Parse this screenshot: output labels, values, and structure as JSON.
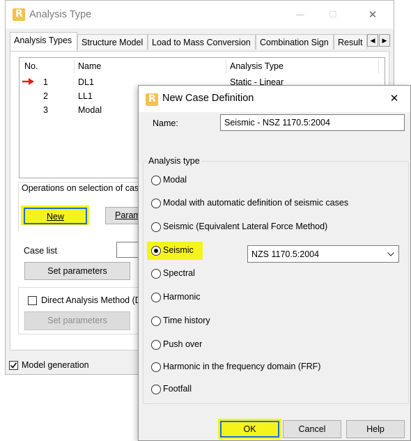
{
  "analysis_window": {
    "title": "Analysis Type",
    "tabs": [
      "Analysis Types",
      "Structure Model",
      "Load to Mass Conversion",
      "Combination Sign",
      "Result"
    ],
    "table": {
      "columns": [
        "No.",
        "Name",
        "Analysis Type"
      ],
      "rows": [
        {
          "no": "1",
          "name": "DL1",
          "type": "Static - Linear",
          "current": true
        },
        {
          "no": "2",
          "name": "LL1",
          "type": ""
        },
        {
          "no": "3",
          "name": "Modal",
          "type": ""
        }
      ]
    },
    "operations_label": "Operations on selection of cas",
    "new_button": "New",
    "parameters_button": "Parame",
    "case_list_label": "Case list",
    "case_list_value": "",
    "set_parameters_button": "Set parameters",
    "dam_checkbox_label": "Direct Analysis Method (DA",
    "dam_checked": false,
    "set_parameters_disabled_button": "Set parameters",
    "model_generation_label": "Model generation",
    "model_generation_checked": true
  },
  "dialog": {
    "title": "New Case Definition",
    "close_glyph": "✕",
    "name_label": "Name:",
    "name_value": "Seismic - NSZ 1170.5:2004",
    "group_title": "Analysis type",
    "options": [
      {
        "label": "Modal",
        "checked": false
      },
      {
        "label": "Modal with automatic definition of seismic cases",
        "checked": false
      },
      {
        "label": "Seismic (Equivalent Lateral Force Method)",
        "checked": false
      },
      {
        "label": "Seismic",
        "checked": true
      },
      {
        "label": "Spectral",
        "checked": false
      },
      {
        "label": "Harmonic",
        "checked": false
      },
      {
        "label": "Time history",
        "checked": false
      },
      {
        "label": "Push over",
        "checked": false
      },
      {
        "label": "Harmonic in the frequency domain (FRF)",
        "checked": false
      },
      {
        "label": "Footfall",
        "checked": false
      }
    ],
    "seismic_code": "NZS 1170.5:2004",
    "ok_button": "OK",
    "cancel_button": "Cancel",
    "help_button": "Help"
  },
  "colors": {
    "highlight": "#f4f41c",
    "focus_border": "#1e6fd0",
    "arrow": "#e01e1e"
  },
  "icons": [
    "app-logo-icon",
    "minimize-icon",
    "maximize-icon",
    "close-icon",
    "current-row-arrow-icon",
    "tab-scroll-left-icon",
    "tab-scroll-right-icon",
    "dropdown-arrow-icon",
    "checkmark-icon"
  ]
}
